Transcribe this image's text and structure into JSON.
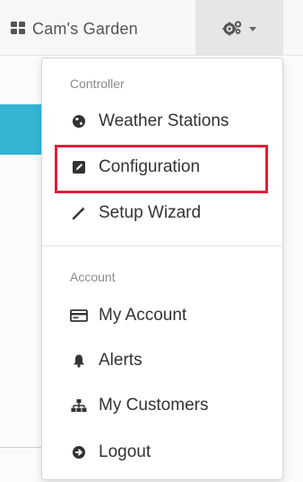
{
  "navbar": {
    "brand_label": "Cam's Garden",
    "brand_icon": "grid-icon",
    "settings_icon": "gears-icon"
  },
  "dropdown": {
    "controller_header": "Controller",
    "controller_items": [
      {
        "label": "Weather Stations",
        "icon": "globe-icon"
      },
      {
        "label": "Configuration",
        "icon": "edit-icon",
        "highlighted": true
      },
      {
        "label": "Setup Wizard",
        "icon": "magic-wand-icon"
      }
    ],
    "account_header": "Account",
    "account_items": [
      {
        "label": "My Account",
        "icon": "card-icon"
      },
      {
        "label": "Alerts",
        "icon": "bell-icon"
      },
      {
        "label": "My Customers",
        "icon": "sitemap-icon"
      },
      {
        "label": "Logout",
        "icon": "logout-icon"
      }
    ]
  },
  "colors": {
    "accent": "#35b4d3",
    "highlight": "#e0203a"
  }
}
